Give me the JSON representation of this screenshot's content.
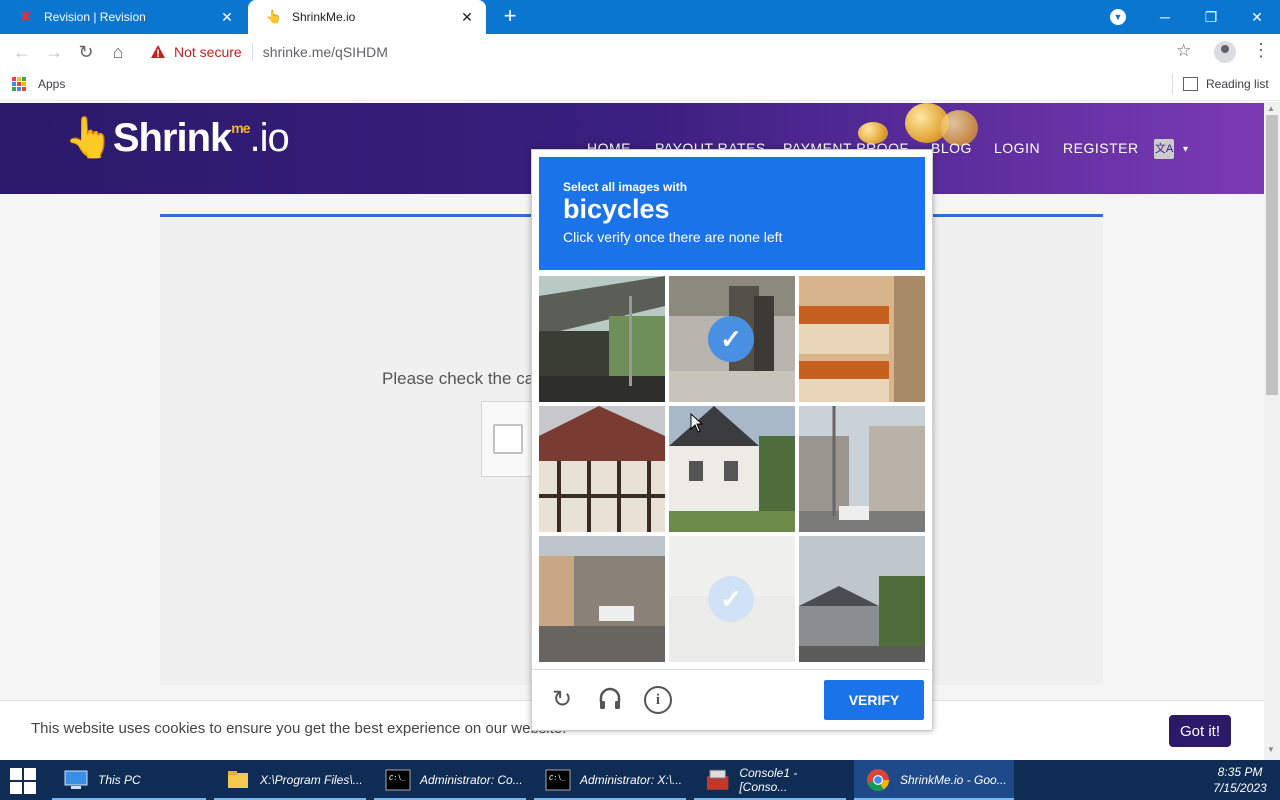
{
  "browser": {
    "tabs": [
      {
        "title": "Revision | Revision",
        "active": false,
        "close": "✕"
      },
      {
        "title": "ShrinkMe.io",
        "active": true,
        "close": "✕"
      }
    ],
    "new_tab": "+",
    "window_controls": {
      "minimize": "─",
      "restore": "❐",
      "close": "✕"
    },
    "nav": {
      "back": "←",
      "forward": "→",
      "reload": "↻",
      "home": "⌂"
    },
    "security_label": "Not secure",
    "url": "shrinke.me/qSIHDM",
    "bookmark_star": "☆",
    "menu": "⋮",
    "bookmarks": {
      "apps_label": "Apps",
      "reading_list_label": "Reading list"
    }
  },
  "site": {
    "logo": {
      "hand": "👆",
      "text": "Shrink",
      "me": "me",
      "io": ".io"
    },
    "nav": [
      "HOME",
      "PAYOUT RATES",
      "PAYMENT PROOF",
      "BLOG",
      "LOGIN",
      "REGISTER"
    ],
    "lang_icon": "文A",
    "lang_caret": "▾",
    "captcha_prompt": "Please check the ca",
    "cookie_text": "This website uses cookies to ensure you get the best experience on our website.",
    "cookie_button": "Got it!"
  },
  "recaptcha": {
    "sub": "Select all images with",
    "target": "bicycles",
    "hint": "Click verify once there are none left",
    "tiles": [
      {
        "scene": "overpass-street",
        "selected": false,
        "faded": false
      },
      {
        "scene": "man-with-cart",
        "selected": true,
        "faded": false
      },
      {
        "scene": "balconies",
        "selected": false,
        "faded": false
      },
      {
        "scene": "timber-house",
        "selected": false,
        "faded": false
      },
      {
        "scene": "white-house",
        "selected": false,
        "faded": false
      },
      {
        "scene": "japanese-street",
        "selected": false,
        "faded": false
      },
      {
        "scene": "town-square",
        "selected": false,
        "faded": false
      },
      {
        "scene": "loading-tile",
        "selected": true,
        "faded": true
      },
      {
        "scene": "suburban-houses",
        "selected": false,
        "faded": false
      }
    ],
    "icons": {
      "reload": "reload-icon",
      "audio": "headphones-icon",
      "info": "info-icon"
    },
    "reload_glyph": "↻",
    "audio_glyph": "🎧",
    "info_glyph": "i",
    "check_glyph": "✓",
    "verify_label": "VERIFY",
    "colors": {
      "header": "#1a73e8",
      "check": "#4a90e2"
    }
  },
  "taskbar": {
    "items": [
      {
        "label": "This PC",
        "icon": "computer-icon"
      },
      {
        "label": "X:\\Program Files\\...",
        "icon": "folder-icon"
      },
      {
        "label": "Administrator: Co...",
        "icon": "cmd-icon"
      },
      {
        "label": "Administrator: X:\\...",
        "icon": "cmd-icon"
      },
      {
        "label": "Console1 - [Conso...",
        "icon": "mmc-icon"
      },
      {
        "label": "ShrinkMe.io - Goo...",
        "icon": "chrome-icon",
        "active": true
      }
    ],
    "time": "8:35 PM",
    "date": "7/15/2023"
  }
}
